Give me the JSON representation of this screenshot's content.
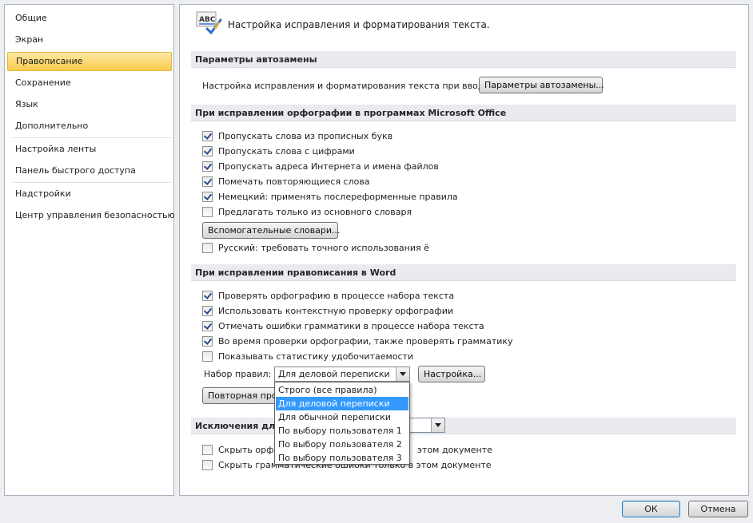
{
  "sidebar": {
    "items": [
      {
        "label": "Общие"
      },
      {
        "label": "Экран"
      },
      {
        "label": "Правописание"
      },
      {
        "label": "Сохранение"
      },
      {
        "label": "Язык"
      },
      {
        "label": "Дополнительно"
      },
      {
        "label": "Настройка ленты"
      },
      {
        "label": "Панель быстрого доступа"
      },
      {
        "label": "Надстройки"
      },
      {
        "label": "Центр управления безопасностью"
      }
    ],
    "active_index": 2
  },
  "header": {
    "icon": "abc-proofing-icon",
    "icon_text": "ABC",
    "title": "Настройка исправления и форматирования текста."
  },
  "autocorrect": {
    "section_title": "Параметры автозамены",
    "label": "Настройка исправления и форматирования текста при вводе:",
    "button": "Параметры автозамены..."
  },
  "office_spelling": {
    "section_title": "При исправлении орфографии в программах Microsoft Office",
    "options": [
      {
        "label": "Пропускать слова из прописных букв",
        "checked": true
      },
      {
        "label": "Пропускать слова с цифрами",
        "checked": true
      },
      {
        "label": "Пропускать адреса Интернета и имена файлов",
        "checked": true
      },
      {
        "label": "Помечать повторяющиеся слова",
        "checked": true
      },
      {
        "label": "Немецкий: применять послереформенные правила",
        "checked": true
      },
      {
        "label": "Предлагать только из основного словаря",
        "checked": false
      }
    ],
    "dictionaries_button": "Вспомогательные словари...",
    "russian_option": {
      "label": "Русский: требовать точного использования ё",
      "checked": false
    }
  },
  "word_spelling": {
    "section_title": "При исправлении правописания в Word",
    "options": [
      {
        "label": "Проверять орфографию в процессе набора текста",
        "checked": true
      },
      {
        "label": "Использовать контекстную проверку орфографии",
        "checked": true
      },
      {
        "label": "Отмечать ошибки грамматики в процессе набора текста",
        "checked": true
      },
      {
        "label": "Во время проверки орфографии, также проверять грамматику",
        "checked": true
      },
      {
        "label": "Показывать статистику удобочитаемости",
        "checked": false
      }
    ],
    "ruleset_label": "Набор правил:",
    "ruleset_value": "Для деловой переписки",
    "settings_button": "Настройка...",
    "recheck_button": "Повторная про",
    "dropdown_options": [
      "Строго (все правила)",
      "Для деловой переписки",
      "Для обычной переписки",
      "По выбору пользователя 1",
      "По выбору пользователя 2",
      "По выбору пользователя 3"
    ],
    "dropdown_selected_index": 1
  },
  "exceptions": {
    "section_title": "Исключения для ф",
    "options": [
      {
        "label_visible_start": "Скрыть орфо",
        "label_visible_end": "этом документе",
        "checked": false
      },
      {
        "label_visible_start": "Скрыть грамматические ошибки только в этом документе",
        "checked": false
      }
    ]
  },
  "footer": {
    "ok": "ОК",
    "cancel": "Отмена"
  }
}
